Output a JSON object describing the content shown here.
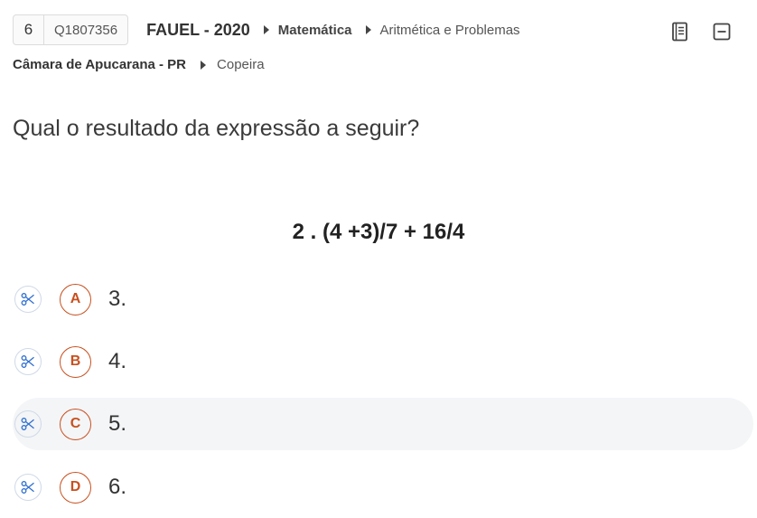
{
  "question": {
    "number": "6",
    "id": "Q1807356",
    "exam": "FAUEL - 2020",
    "subject": "Matemática",
    "topic": "Aritmética e Problemas",
    "organization": "Câmara de Apucarana - PR",
    "position": "Copeira",
    "statement": "Qual o resultado da expressão a seguir?",
    "expression": "2 . (4 +3)/7 + 16/4"
  },
  "tools": {
    "notebook_icon": "notebook-icon",
    "collapse_icon": "collapse-icon"
  },
  "options": [
    {
      "letter": "A",
      "text": "3."
    },
    {
      "letter": "B",
      "text": "4."
    },
    {
      "letter": "C",
      "text": "5."
    },
    {
      "letter": "D",
      "text": "6."
    }
  ],
  "selected_option": "C",
  "colors": {
    "accent": "#c8501e",
    "scissors": "#2f6fd0",
    "selected_bg": "#f4f5f7"
  }
}
